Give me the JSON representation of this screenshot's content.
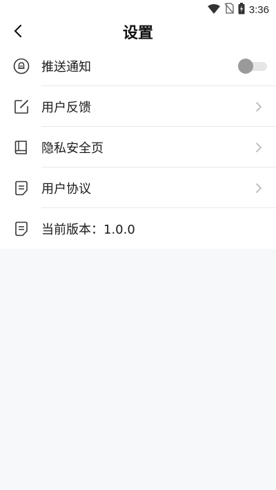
{
  "status_bar": {
    "time": "3:36",
    "icons": [
      "wifi-icon",
      "no-sim-icon",
      "battery-charging-icon"
    ]
  },
  "header": {
    "title": "设置",
    "back_icon": "chevron-left-icon"
  },
  "settings": {
    "items": [
      {
        "label": "推送通知",
        "icon": "push-notification-icon",
        "control": "toggle",
        "toggle_on": false
      },
      {
        "label": "用户反馈",
        "icon": "feedback-edit-icon",
        "control": "chevron"
      },
      {
        "label": "隐私安全页",
        "icon": "book-icon",
        "control": "chevron"
      },
      {
        "label": "用户协议",
        "icon": "document-icon",
        "control": "chevron"
      },
      {
        "label": "当前版本：1.0.0",
        "icon": "document-icon",
        "control": "none"
      }
    ]
  },
  "colors": {
    "background": "#f7f8fa",
    "surface": "#ffffff",
    "divider": "#e8e8e8",
    "icon": "#333333",
    "chevron": "#b5b5b5",
    "toggle_track": "#e6e6e6",
    "toggle_knob": "#9a9a9a"
  }
}
